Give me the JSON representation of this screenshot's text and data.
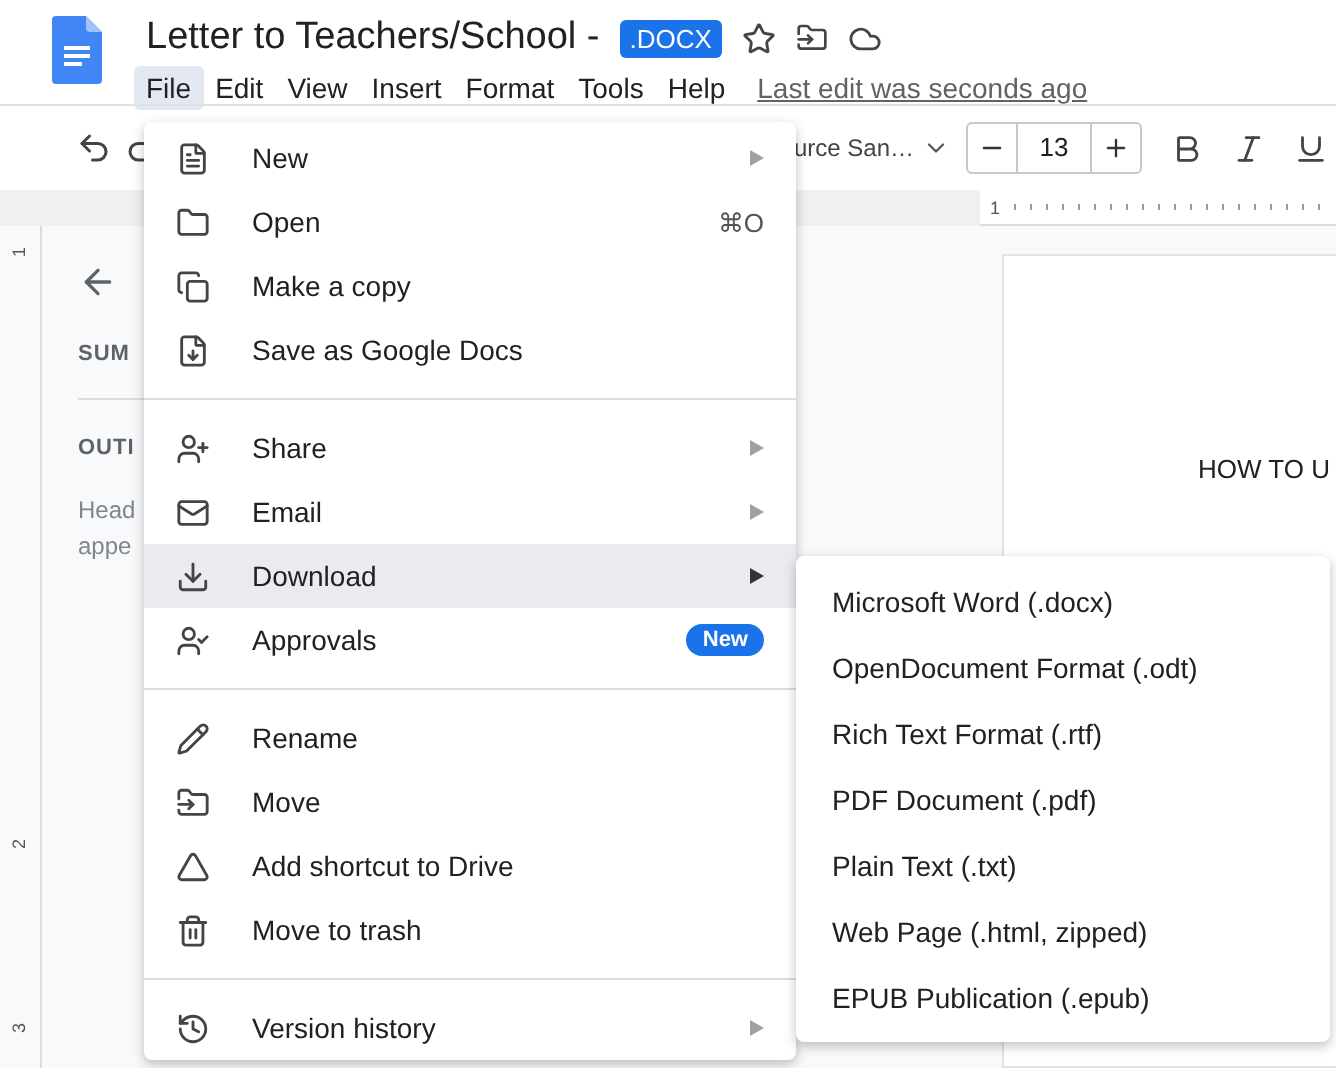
{
  "doc": {
    "title": "Letter to Teachers/School -",
    "badge": ".DOCX"
  },
  "menubar": [
    {
      "label": "File",
      "selected": true
    },
    {
      "label": "Edit",
      "selected": false
    },
    {
      "label": "View",
      "selected": false
    },
    {
      "label": "Insert",
      "selected": false
    },
    {
      "label": "Format",
      "selected": false
    },
    {
      "label": "Tools",
      "selected": false
    },
    {
      "label": "Help",
      "selected": false
    }
  ],
  "last_edit": "Last edit was seconds ago",
  "toolbar": {
    "font": "urce San…",
    "font_size": "13"
  },
  "ruler": {
    "mark": "1"
  },
  "vertical_ruler": [
    "1",
    "2",
    "3"
  ],
  "sidebar": {
    "summary": "SUM",
    "outline": "OUTI",
    "hint_lines": [
      "Head",
      "appe"
    ]
  },
  "page": {
    "heading": "HOW TO U"
  },
  "file_menu": [
    {
      "kind": "item",
      "label": "New",
      "submenu": true,
      "selected": false
    },
    {
      "kind": "item",
      "label": "Open",
      "shortcut": "⌘O",
      "submenu": false,
      "selected": false
    },
    {
      "kind": "item",
      "label": "Make a copy",
      "submenu": false,
      "selected": false
    },
    {
      "kind": "item",
      "label": "Save as Google Docs",
      "submenu": false,
      "selected": false
    },
    {
      "kind": "divider"
    },
    {
      "kind": "item",
      "label": "Share",
      "submenu": true,
      "selected": false
    },
    {
      "kind": "item",
      "label": "Email",
      "submenu": true,
      "selected": false
    },
    {
      "kind": "item",
      "label": "Download",
      "submenu": true,
      "selected": true
    },
    {
      "kind": "item",
      "label": "Approvals",
      "badge": "New",
      "submenu": false,
      "selected": false
    },
    {
      "kind": "divider"
    },
    {
      "kind": "item",
      "label": "Rename",
      "submenu": false,
      "selected": false
    },
    {
      "kind": "item",
      "label": "Move",
      "submenu": false,
      "selected": false
    },
    {
      "kind": "item",
      "label": "Add shortcut to Drive",
      "submenu": false,
      "selected": false
    },
    {
      "kind": "item",
      "label": "Move to trash",
      "submenu": false,
      "selected": false
    },
    {
      "kind": "divider"
    },
    {
      "kind": "item",
      "label": "Version history",
      "submenu": true,
      "selected": false
    }
  ],
  "download_menu": [
    "Microsoft Word (.docx)",
    "OpenDocument Format (.odt)",
    "Rich Text Format (.rtf)",
    "PDF Document (.pdf)",
    "Plain Text (.txt)",
    "Web Page (.html, zipped)",
    "EPUB Publication (.epub)"
  ]
}
